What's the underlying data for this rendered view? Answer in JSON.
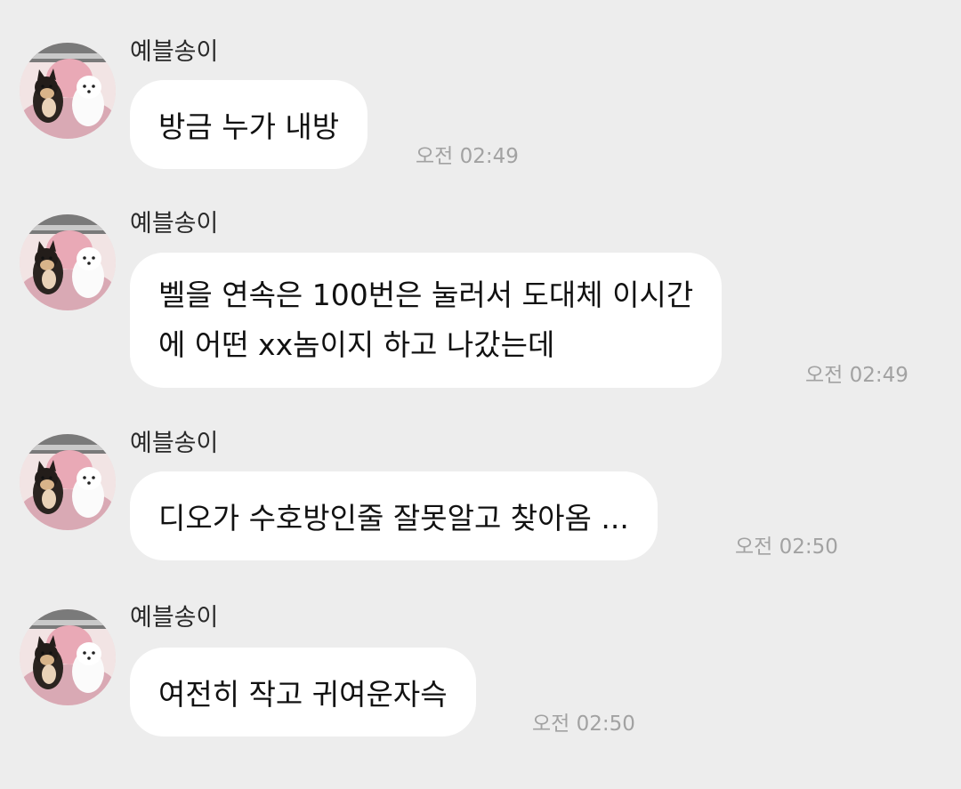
{
  "messages": [
    {
      "sender": "예블송이",
      "avatar": "two-dogs-avatar",
      "text": "방금 누가 내방",
      "time": "오전 02:49"
    },
    {
      "sender": "예블송이",
      "avatar": "two-dogs-avatar",
      "lines": [
        "벨을 연속은 100번은 눌러서 도대체 이시간",
        "에 어떤 xx놈이지 하고 나갔는데"
      ],
      "time": "오전 02:49"
    },
    {
      "sender": "예블송이",
      "avatar": "two-dogs-avatar",
      "text": "디오가 수호방인줄 잘못알고 찾아옴 ...",
      "time": "오전 02:50"
    },
    {
      "sender": "예블송이",
      "avatar": "two-dogs-avatar",
      "text": "여전히 작고 귀여운자슥",
      "time": "오전 02:50"
    }
  ],
  "colors": {
    "background": "#ededed",
    "bubble": "#ffffff",
    "timestamp": "#a2a2a2"
  }
}
